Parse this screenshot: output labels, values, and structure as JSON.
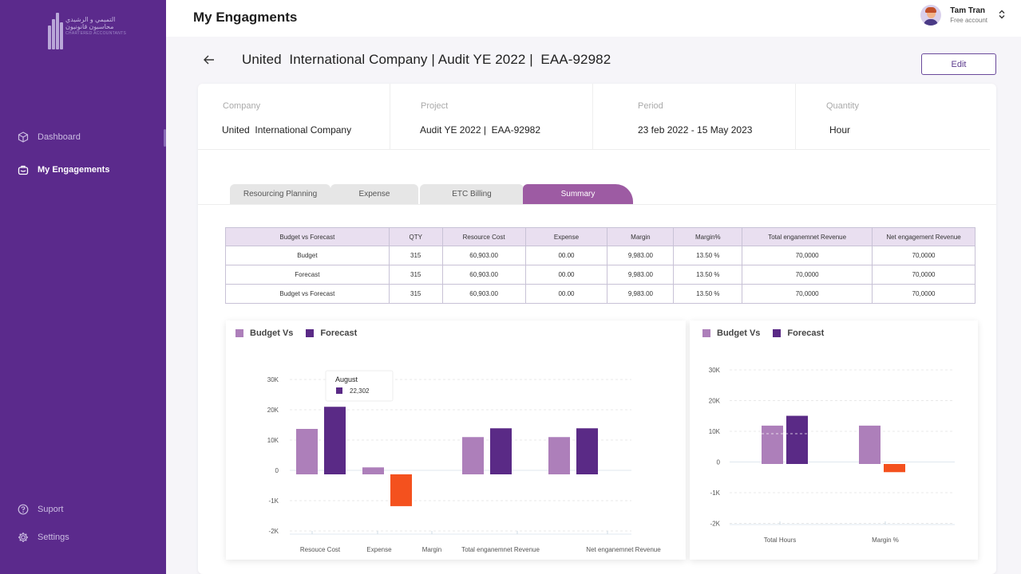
{
  "sidebar": {
    "logo": {
      "text_ar1": "التميمي و الرشيدي",
      "text_ar2": "محاسبون قانونيون",
      "text_en": "CHARTERED ACCOUNTANTS"
    },
    "items": [
      {
        "label": "Dashboard",
        "icon": "cube-icon"
      },
      {
        "label": "My Engagements",
        "icon": "briefcase-icon"
      }
    ],
    "footer_items": [
      {
        "label": "Suport",
        "icon": "help-circle-icon"
      },
      {
        "label": "Settings",
        "icon": "gear-icon"
      }
    ]
  },
  "header": {
    "title": "My Engagments",
    "user": {
      "name": "Tam Tran",
      "plan": "Free account"
    }
  },
  "engagement": {
    "title": "United  International Company | Audit YE 2022 |  EAA-92982",
    "edit_label": "Edit",
    "info": [
      {
        "label": "Company",
        "value": "United  International Company"
      },
      {
        "label": "Project",
        "value": "Audit YE 2022 |  EAA-92982"
      },
      {
        "label": "Period",
        "value": "23 feb 2022 - 15 May 2023"
      },
      {
        "label": "Quantity",
        "value": "Hour"
      }
    ]
  },
  "tabs": [
    {
      "label": "Resourcing Planning"
    },
    {
      "label": "Expense"
    },
    {
      "label": "ETC Billing"
    },
    {
      "label": "Summary"
    }
  ],
  "summary_table": {
    "headers": [
      "Budget vs Forecast",
      "QTY",
      "Resource Cost",
      "Expense",
      "Margin",
      "Margin%",
      "Total enganemnet Revenue",
      "Net engagement Revenue"
    ],
    "rows": [
      [
        "Budget",
        "315",
        "60,903.00",
        "00.00",
        "9,983.00",
        "13.50 %",
        "70,0000",
        "70,0000"
      ],
      [
        "Forecast",
        "315",
        "60,903.00",
        "00.00",
        "9,983.00",
        "13.50 %",
        "70,0000",
        "70,0000"
      ],
      [
        "Budget vs Forecast",
        "315",
        "60,903.00",
        "00.00",
        "9,983.00",
        "13.50 %",
        "70,0000",
        "70,0000"
      ]
    ]
  },
  "colors": {
    "budget": "#ad7fba",
    "forecast": "#5a2a86",
    "negative": "#f4511e",
    "sidebar": "#5b2a8c"
  },
  "chart_data": [
    {
      "type": "bar",
      "legend": [
        "Budget Vs",
        "Forecast"
      ],
      "categories": [
        "Resouce Cost",
        "Expense",
        "Margin",
        "Total enganemnet Revenue",
        "Net enganemnet Revenue"
      ],
      "series": [
        {
          "name": "Budget Vs",
          "values": [
            15000,
            2300,
            null,
            12300,
            12300
          ]
        },
        {
          "name": "Forecast",
          "values": [
            22302,
            -10500,
            null,
            15200,
            15200
          ]
        }
      ],
      "y_ticks": [
        "30K",
        "20K",
        "10K",
        "0",
        "-1K",
        "-2K"
      ],
      "tooltip": {
        "title": "August",
        "value": "22,302"
      }
    },
    {
      "type": "bar",
      "legend": [
        "Budget Vs",
        "Forecast"
      ],
      "categories": [
        "Total Hours",
        "Margin %"
      ],
      "series": [
        {
          "name": "Budget Vs",
          "values": [
            12500,
            12500
          ]
        },
        {
          "name": "Forecast",
          "values": [
            15700,
            -2700
          ]
        }
      ],
      "y_ticks": [
        "30K",
        "20K",
        "10K",
        "0",
        "-1K",
        "-2K"
      ]
    }
  ]
}
